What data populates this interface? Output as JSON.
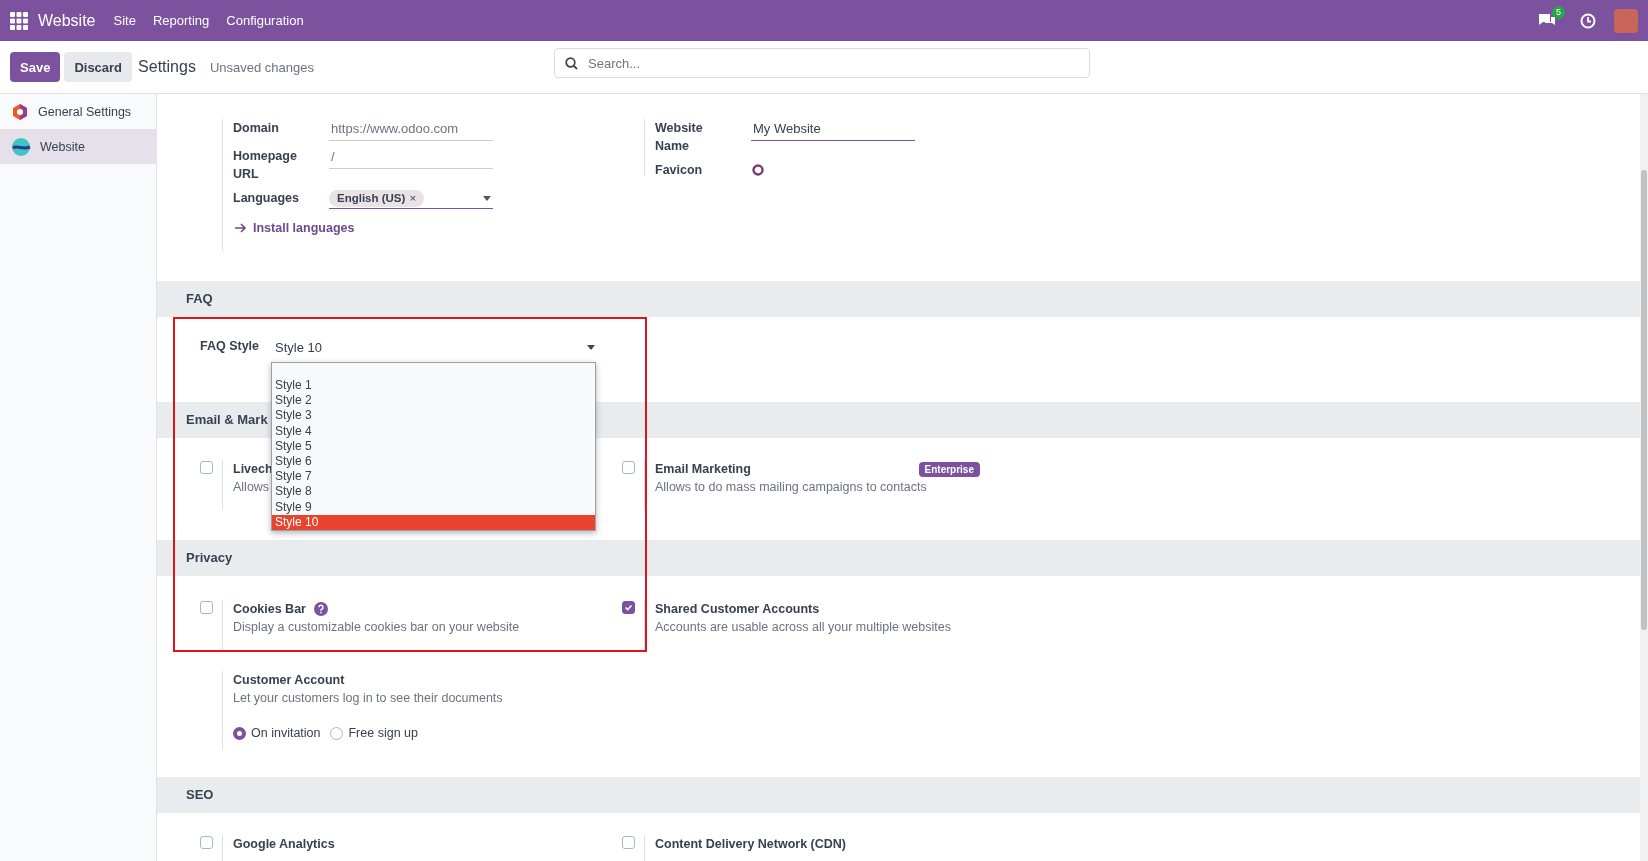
{
  "navbar": {
    "app": "Website",
    "menus": [
      "Site",
      "Reporting",
      "Configuration"
    ],
    "chat_badge": "5"
  },
  "control": {
    "save": "Save",
    "discard": "Discard",
    "title": "Settings",
    "status": "Unsaved changes",
    "search": {
      "placeholder": "Search..."
    }
  },
  "sidebar": {
    "items": [
      {
        "label": "General Settings",
        "selected": false
      },
      {
        "label": "Website",
        "selected": true
      }
    ]
  },
  "website": {
    "left": [
      {
        "kind": "input",
        "label": "Domain",
        "placeholder": "https://www.odoo.com"
      },
      {
        "kind": "input",
        "label": "Homepage URL",
        "placeholder": "/"
      },
      {
        "kind": "tags",
        "label": "Languages",
        "tags": [
          {
            "label": "English (US)",
            "remove": "×"
          }
        ]
      }
    ],
    "install_link": "Install languages",
    "right": [
      {
        "kind": "input",
        "label": "Website Name",
        "value": "My Website"
      },
      {
        "kind": "image",
        "label": "Favicon"
      }
    ]
  },
  "sections": [
    {
      "title": "FAQ",
      "kind": "select",
      "label": "FAQ Style",
      "value": "Style 10",
      "options": [
        {
          "label": "Style 1",
          "selected": false
        },
        {
          "label": "Style 2",
          "selected": false
        },
        {
          "label": "Style 3",
          "selected": false
        },
        {
          "label": "Style 4",
          "selected": false
        },
        {
          "label": "Style 5",
          "selected": false
        },
        {
          "label": "Style 6",
          "selected": false
        },
        {
          "label": "Style 7",
          "selected": false
        },
        {
          "label": "Style 8",
          "selected": false
        },
        {
          "label": "Style 9",
          "selected": false
        },
        {
          "label": "Style 10",
          "selected": true
        }
      ]
    },
    {
      "title": "Email & Mark",
      "kind": "settings",
      "settings": [
        {
          "title": "Livech",
          "description": "Allows",
          "checked": false
        },
        {
          "title": "Email Marketing",
          "description": "Allows to do mass mailing campaigns to contacts",
          "checked": false,
          "badge": "Enterprise"
        }
      ]
    },
    {
      "title": "Privacy",
      "kind": "settings",
      "settings": [
        {
          "title": "Cookies Bar",
          "help": true,
          "description": "Display a customizable cookies bar on your website",
          "checked": false
        },
        {
          "title": "Shared Customer Accounts",
          "description": "Accounts are usable across all your multiple websites",
          "checked": true
        }
      ],
      "extra": {
        "title": "Customer Account",
        "description": "Let your customers log in to see their documents",
        "options": [
          {
            "label": "On invitation",
            "selected": true
          },
          {
            "label": "Free sign up",
            "selected": false
          }
        ]
      }
    },
    {
      "title": "SEO",
      "kind": "settings",
      "settings": [
        {
          "title": "Google Analytics",
          "checked": false
        },
        {
          "title": "Content Delivery Network (CDN)",
          "checked": false
        }
      ]
    }
  ]
}
